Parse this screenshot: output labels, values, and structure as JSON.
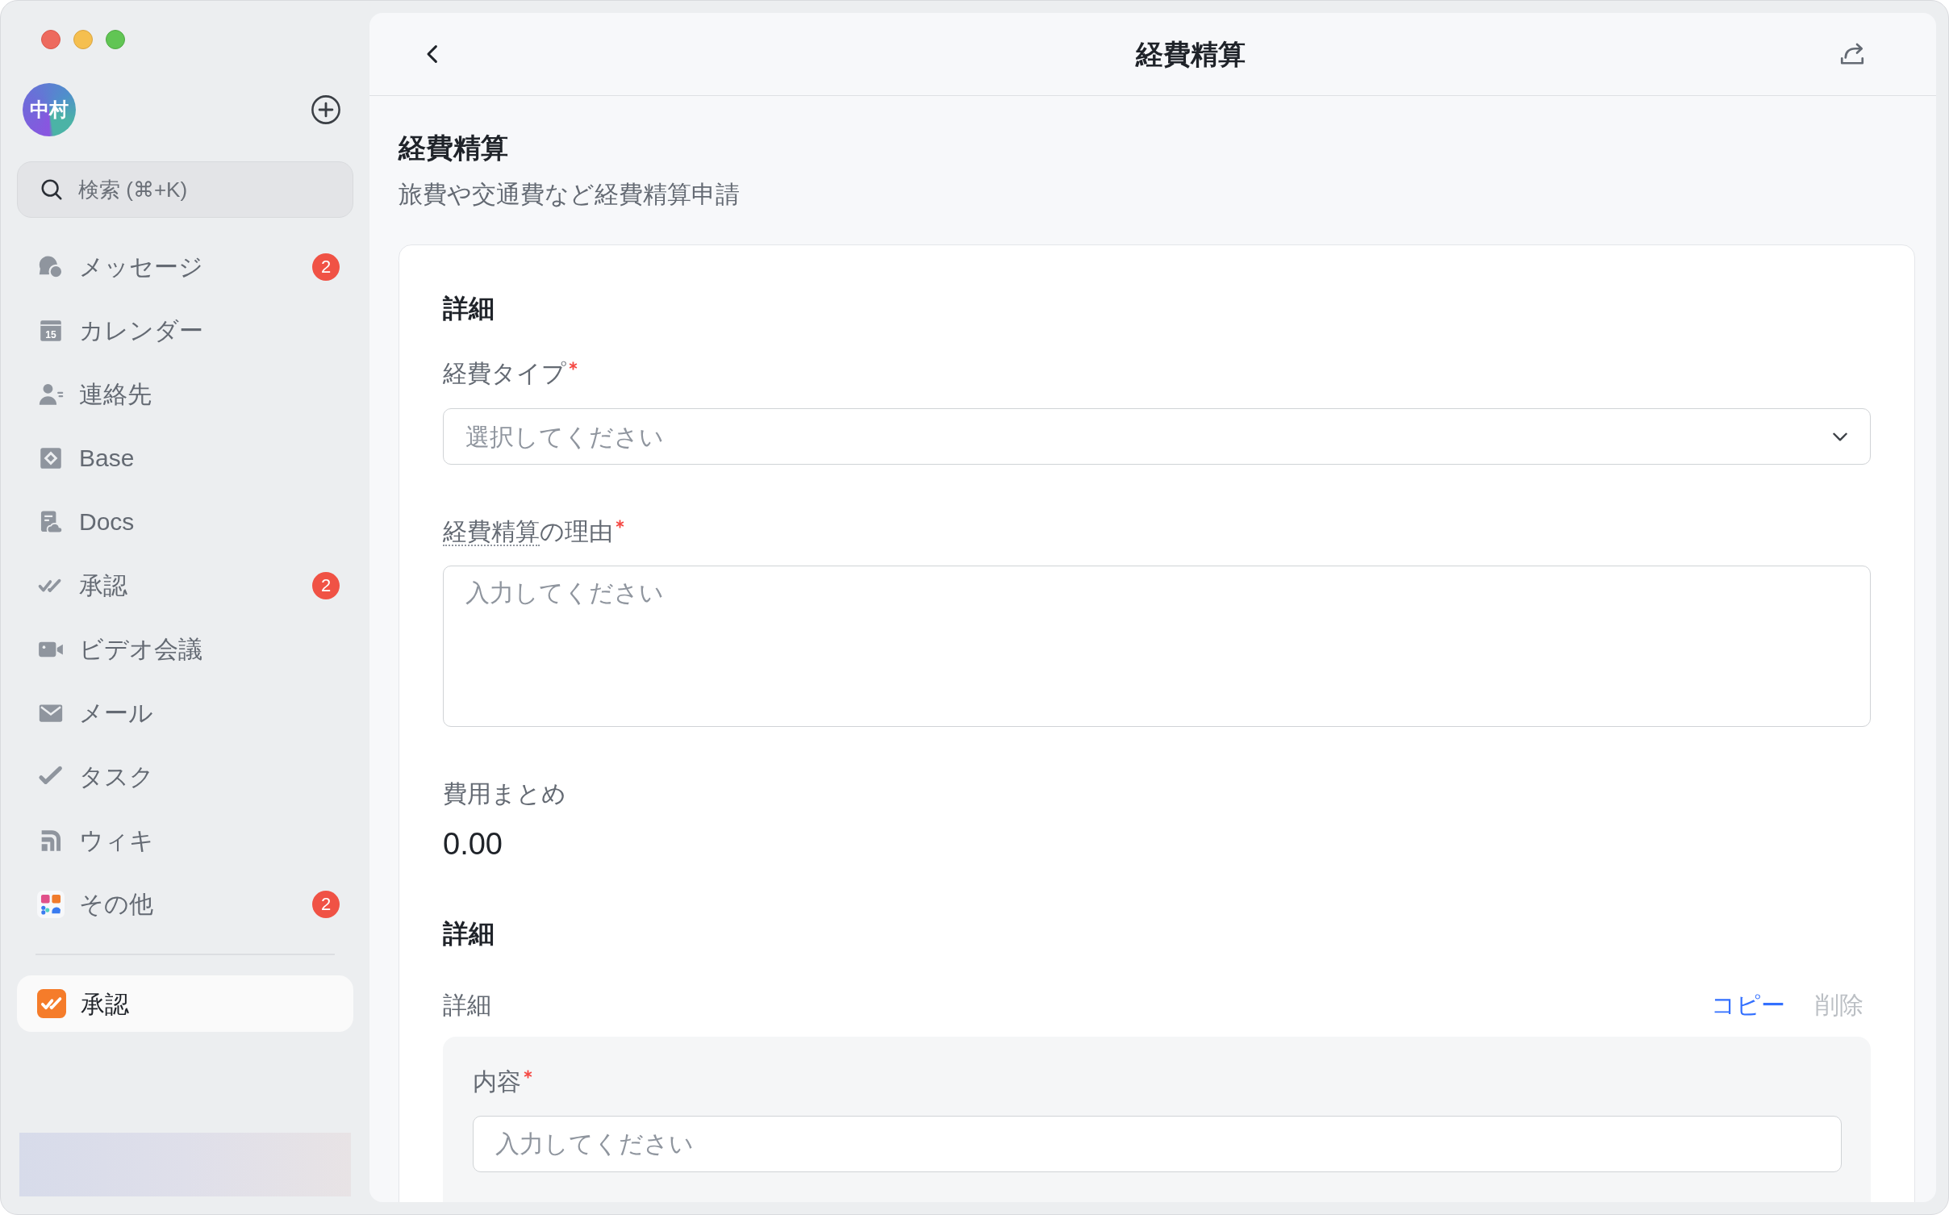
{
  "sidebar": {
    "avatar": {
      "initials": "中村"
    },
    "search": {
      "placeholder": "検索 (⌘+K)"
    },
    "items": [
      {
        "label": "メッセージ",
        "badge": "2",
        "selected": false
      },
      {
        "label": "カレンダー",
        "icon_text": "15",
        "selected": false
      },
      {
        "label": "連絡先",
        "selected": false
      },
      {
        "label": "Base",
        "selected": false
      },
      {
        "label": "Docs",
        "selected": false
      },
      {
        "label": "承認",
        "badge": "2",
        "selected": false
      },
      {
        "label": "ビデオ会議",
        "selected": false
      },
      {
        "label": "メール",
        "selected": false
      },
      {
        "label": "タスク",
        "selected": false
      },
      {
        "label": "ウィキ",
        "selected": false
      },
      {
        "label": "その他",
        "badge": "2",
        "selected": false
      }
    ],
    "pinned": [
      {
        "label": "承認",
        "selected": true
      }
    ]
  },
  "header": {
    "title": "経費精算"
  },
  "page": {
    "title": "経費精算",
    "subtitle": "旅費や交通費など経費精算申請"
  },
  "form": {
    "title": "詳細",
    "fields": [
      {
        "kind": "select",
        "label_parts": [
          {
            "text": "経費タイプ",
            "underlined": false
          }
        ],
        "required": true,
        "placeholder": "選択してください"
      },
      {
        "kind": "textarea",
        "label_parts": [
          {
            "text": "経費精算",
            "underlined": true
          },
          {
            "text": "の理由",
            "underlined": false
          }
        ],
        "required": true,
        "placeholder": "入力してください"
      },
      {
        "kind": "readout",
        "label_parts": [
          {
            "text": "費用まとめ",
            "underlined": false
          }
        ],
        "value": "0.00"
      }
    ]
  },
  "details": {
    "title": "詳細",
    "entries": [
      {
        "label": "詳細",
        "actions": [
          {
            "label": "コピー",
            "disabled": false
          },
          {
            "label": "削除",
            "disabled": true
          }
        ],
        "fields": [
          {
            "label": "内容",
            "required": true,
            "placeholder": "入力してください"
          }
        ]
      }
    ]
  }
}
